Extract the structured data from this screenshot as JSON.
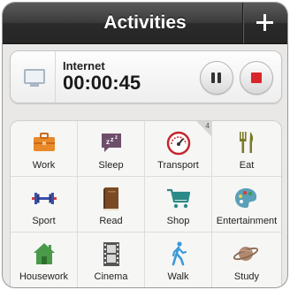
{
  "navbar": {
    "title": "Activities",
    "add_icon": "plus-icon"
  },
  "timer": {
    "activity": "Internet",
    "elapsed": "00:00:45",
    "activity_icon": "monitor-icon",
    "pause_icon": "pause-icon",
    "stop_icon": "stop-icon"
  },
  "activities": [
    {
      "label": "Work",
      "icon": "briefcase-icon"
    },
    {
      "label": "Sleep",
      "icon": "sleep-bubble-icon"
    },
    {
      "label": "Transport",
      "icon": "speedometer-icon",
      "badge": "4"
    },
    {
      "label": "Eat",
      "icon": "fork-knife-icon"
    },
    {
      "label": "Sport",
      "icon": "dumbbell-icon"
    },
    {
      "label": "Read",
      "icon": "book-icon"
    },
    {
      "label": "Shop",
      "icon": "shopping-cart-icon"
    },
    {
      "label": "Entertainment",
      "icon": "palette-icon"
    },
    {
      "label": "Housework",
      "icon": "house-icon"
    },
    {
      "label": "Cinema",
      "icon": "film-strip-icon"
    },
    {
      "label": "Walk",
      "icon": "walking-person-icon"
    },
    {
      "label": "Study",
      "icon": "planet-icon"
    }
  ],
  "colors": {
    "navbar": "#2f2f2f",
    "stop": "#d8262b",
    "work": "#e8892a",
    "sleep": "#6e4f6b",
    "transport": "#c2272d",
    "eat": "#7a7a2a",
    "sport": "#3a4fa8",
    "read": "#7a4a24",
    "shop": "#2a8a88",
    "entertainment": "#5aa0b8",
    "housework": "#4a9a4a",
    "cinema": "#555555",
    "walk": "#3a9ad8",
    "study": "#b08a70"
  }
}
